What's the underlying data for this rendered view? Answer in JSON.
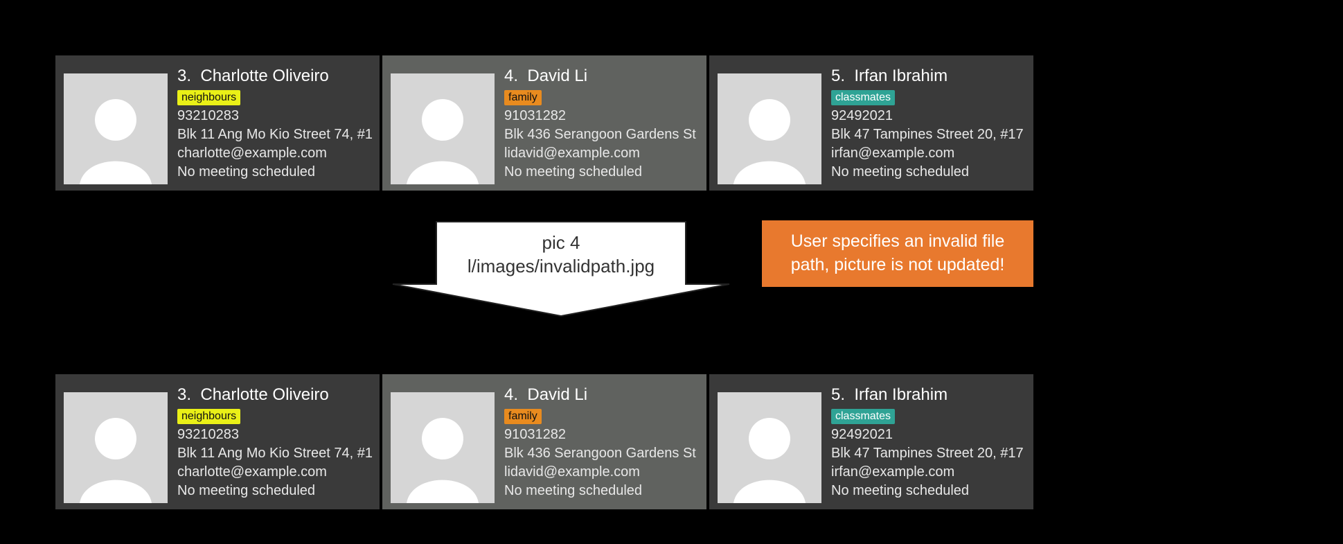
{
  "tag_colors": {
    "neighbours": "#eaf017",
    "family": "#e98b1f",
    "classmates": "#2fa395"
  },
  "rows": {
    "top": [
      {
        "index": "3.",
        "name": "Charlotte Oliveiro",
        "tag": "neighbours",
        "phone": "93210283",
        "address": "Blk 11 Ang Mo Kio Street 74, #1",
        "email": "charlotte@example.com",
        "meeting": "No meeting scheduled",
        "selected": false
      },
      {
        "index": "4.",
        "name": "David Li",
        "tag": "family",
        "phone": "91031282",
        "address": "Blk 436 Serangoon Gardens St",
        "email": "lidavid@example.com",
        "meeting": "No meeting scheduled",
        "selected": true
      },
      {
        "index": "5.",
        "name": "Irfan Ibrahim",
        "tag": "classmates",
        "phone": "92492021",
        "address": "Blk 47 Tampines Street 20, #17",
        "email": "irfan@example.com",
        "meeting": "No meeting scheduled",
        "selected": false
      }
    ],
    "bottom": [
      {
        "index": "3.",
        "name": "Charlotte Oliveiro",
        "tag": "neighbours",
        "phone": "93210283",
        "address": "Blk 11 Ang Mo Kio Street 74, #1",
        "email": "charlotte@example.com",
        "meeting": "No meeting scheduled",
        "selected": false
      },
      {
        "index": "4.",
        "name": "David Li",
        "tag": "family",
        "phone": "91031282",
        "address": "Blk 436 Serangoon Gardens St",
        "email": "lidavid@example.com",
        "meeting": "No meeting scheduled",
        "selected": true
      },
      {
        "index": "5.",
        "name": "Irfan Ibrahim",
        "tag": "classmates",
        "phone": "92492021",
        "address": "Blk 47 Tampines Street 20, #17",
        "email": "irfan@example.com",
        "meeting": "No meeting scheduled",
        "selected": false
      }
    ]
  },
  "arrow": {
    "line1": "pic 4",
    "line2": "l/images/invalidpath.jpg"
  },
  "callout": {
    "text": "User specifies an invalid file path, picture is not updated!"
  }
}
